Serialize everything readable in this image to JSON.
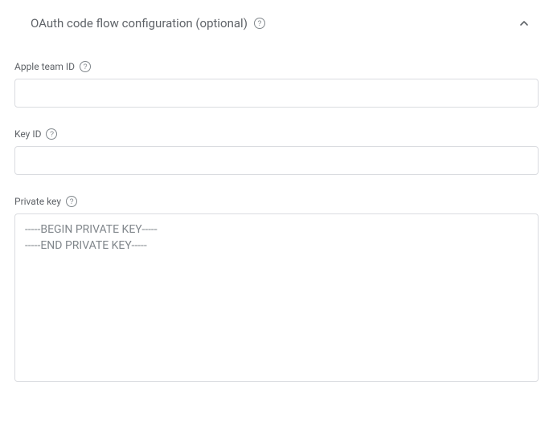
{
  "section": {
    "title": "OAuth code flow configuration (optional)"
  },
  "fields": {
    "team_id": {
      "label": "Apple team ID",
      "value": ""
    },
    "key_id": {
      "label": "Key ID",
      "value": ""
    },
    "private_key": {
      "label": "Private key",
      "placeholder": "-----BEGIN PRIVATE KEY-----\n-----END PRIVATE KEY-----",
      "value": ""
    }
  }
}
